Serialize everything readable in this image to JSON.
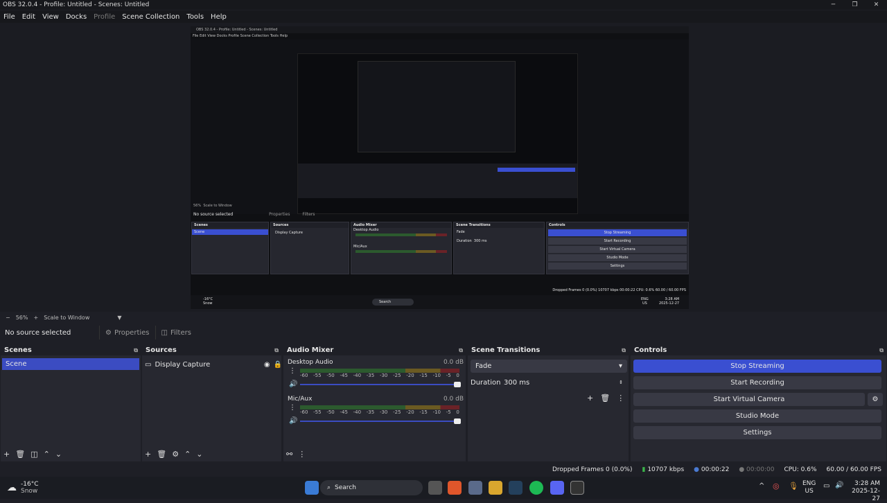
{
  "window": {
    "title": "OBS 32.0.4 - Profile: Untitled - Scenes: Untitled"
  },
  "menu": {
    "items": [
      "File",
      "Edit",
      "View",
      "Docks",
      "Profile",
      "Scene Collection",
      "Tools",
      "Help"
    ]
  },
  "nested_preview": {
    "title": "OBS 32.0.4 - Profile: Untitled - Scenes: Untitled",
    "menu": "File   Edit   View   Docks   Profile   Scene Collection   Tools   Help",
    "zoom": "56%",
    "scale_mode": "Scale to Window",
    "no_source": "No source selected",
    "properties": "Properties",
    "filters": "Filters",
    "scenes_header": "Scenes",
    "scene_item": "Scene",
    "sources_header": "Sources",
    "source_item": "Display Capture",
    "audio_header": "Audio Mixer",
    "desktop_audio": "Desktop Audio",
    "mic_aux": "Mic/Aux",
    "db": "0.0 dB",
    "transitions_header": "Scene Transitions",
    "fade": "Fade",
    "duration_label": "Duration",
    "duration_value": "300 ms",
    "controls_header": "Controls",
    "stop_streaming": "Stop Streaming",
    "start_recording": "Start Recording",
    "start_virtual_camera": "Start Virtual Camera",
    "studio_mode": "Studio Mode",
    "settings": "Settings",
    "status": "Dropped Frames 0 (0.0%)   10707 kbps   00:00:22   CPU: 0.6%   60.00 / 60.00 FPS",
    "temp": "-16°C",
    "weather": "Snow",
    "search": "Search",
    "lang": "ENG",
    "region": "US",
    "time": "3:28 AM",
    "date": "2025-12-27"
  },
  "zoom": {
    "value": "56%",
    "mode": "Scale to Window"
  },
  "source_toolbar": {
    "no_source": "No source selected",
    "properties": "Properties",
    "filters": "Filters"
  },
  "scenes": {
    "header": "Scenes",
    "items": [
      "Scene"
    ]
  },
  "sources": {
    "header": "Sources",
    "items": [
      "Display Capture"
    ]
  },
  "audio_mixer": {
    "header": "Audio Mixer",
    "ticks": [
      "-60",
      "-55",
      "-50",
      "-45",
      "-40",
      "-35",
      "-30",
      "-25",
      "-20",
      "-15",
      "-10",
      "-5",
      "0"
    ],
    "channels": [
      {
        "name": "Desktop Audio",
        "db": "0.0 dB"
      },
      {
        "name": "Mic/Aux",
        "db": "0.0 dB"
      }
    ]
  },
  "transitions": {
    "header": "Scene Transitions",
    "selected": "Fade",
    "duration_label": "Duration",
    "duration_value": "300 ms"
  },
  "controls": {
    "header": "Controls",
    "stop_streaming": "Stop Streaming",
    "start_recording": "Start Recording",
    "start_virtual_camera": "Start Virtual Camera",
    "studio_mode": "Studio Mode",
    "settings": "Settings"
  },
  "status": {
    "dropped_frames": "Dropped Frames 0 (0.0%)",
    "bitrate": "10707 kbps",
    "stream_time": "00:00:22",
    "record_time": "00:00:00",
    "cpu": "CPU: 0.6%",
    "fps": "60.00 / 60.00 FPS"
  },
  "taskbar": {
    "temperature": "-16°C",
    "weather": "Snow",
    "search_placeholder": "Search",
    "language": "ENG",
    "region": "US",
    "time": "3:28 AM",
    "date": "2025-12-27"
  },
  "colors": {
    "accent": "#3a4fd1",
    "panel": "#272830",
    "background": "#1e1f26"
  }
}
